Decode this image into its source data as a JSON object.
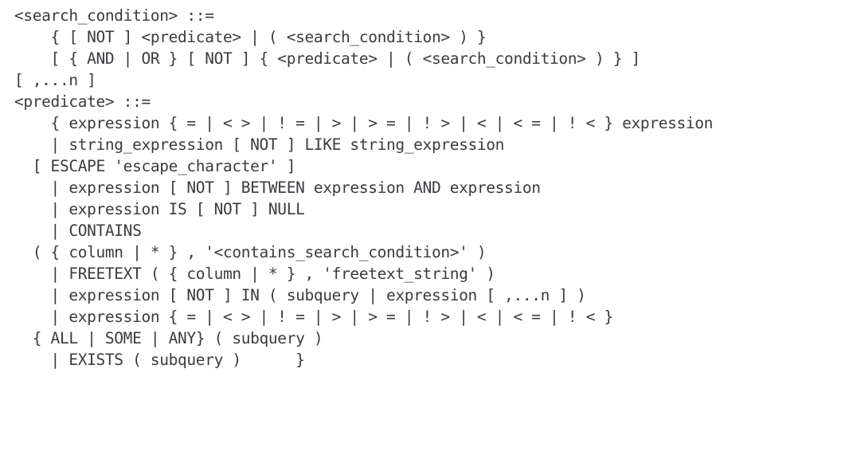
{
  "document": {
    "kind": "sql-syntax-reference",
    "title": "search_condition syntax",
    "background_color": "#ffffff",
    "text_color": "#3b3b40",
    "font_style": "monospace",
    "lines": [
      "<search_condition> ::=",
      "    { [ NOT ] <predicate> | ( <search_condition> ) }",
      "    [ { AND | OR } [ NOT ] { <predicate> | ( <search_condition> ) } ]",
      "[ ,...n ]",
      "<predicate> ::=",
      "    { expression { = | < > | ! = | > | > = | ! > | < | < = | ! < } expression",
      "    | string_expression [ NOT ] LIKE string_expression",
      "  [ ESCAPE 'escape_character' ]",
      "    | expression [ NOT ] BETWEEN expression AND expression",
      "    | expression IS [ NOT ] NULL",
      "    | CONTAINS",
      "  ( { column | * } , '<contains_search_condition>' )",
      "    | FREETEXT ( { column | * } , 'freetext_string' )",
      "    | expression [ NOT ] IN ( subquery | expression [ ,...n ] )",
      "    | expression { = | < > | ! = | > | > = | ! > | < | < = | ! < }",
      "  { ALL | SOME | ANY} ( subquery )",
      "    | EXISTS ( subquery )      }"
    ]
  }
}
